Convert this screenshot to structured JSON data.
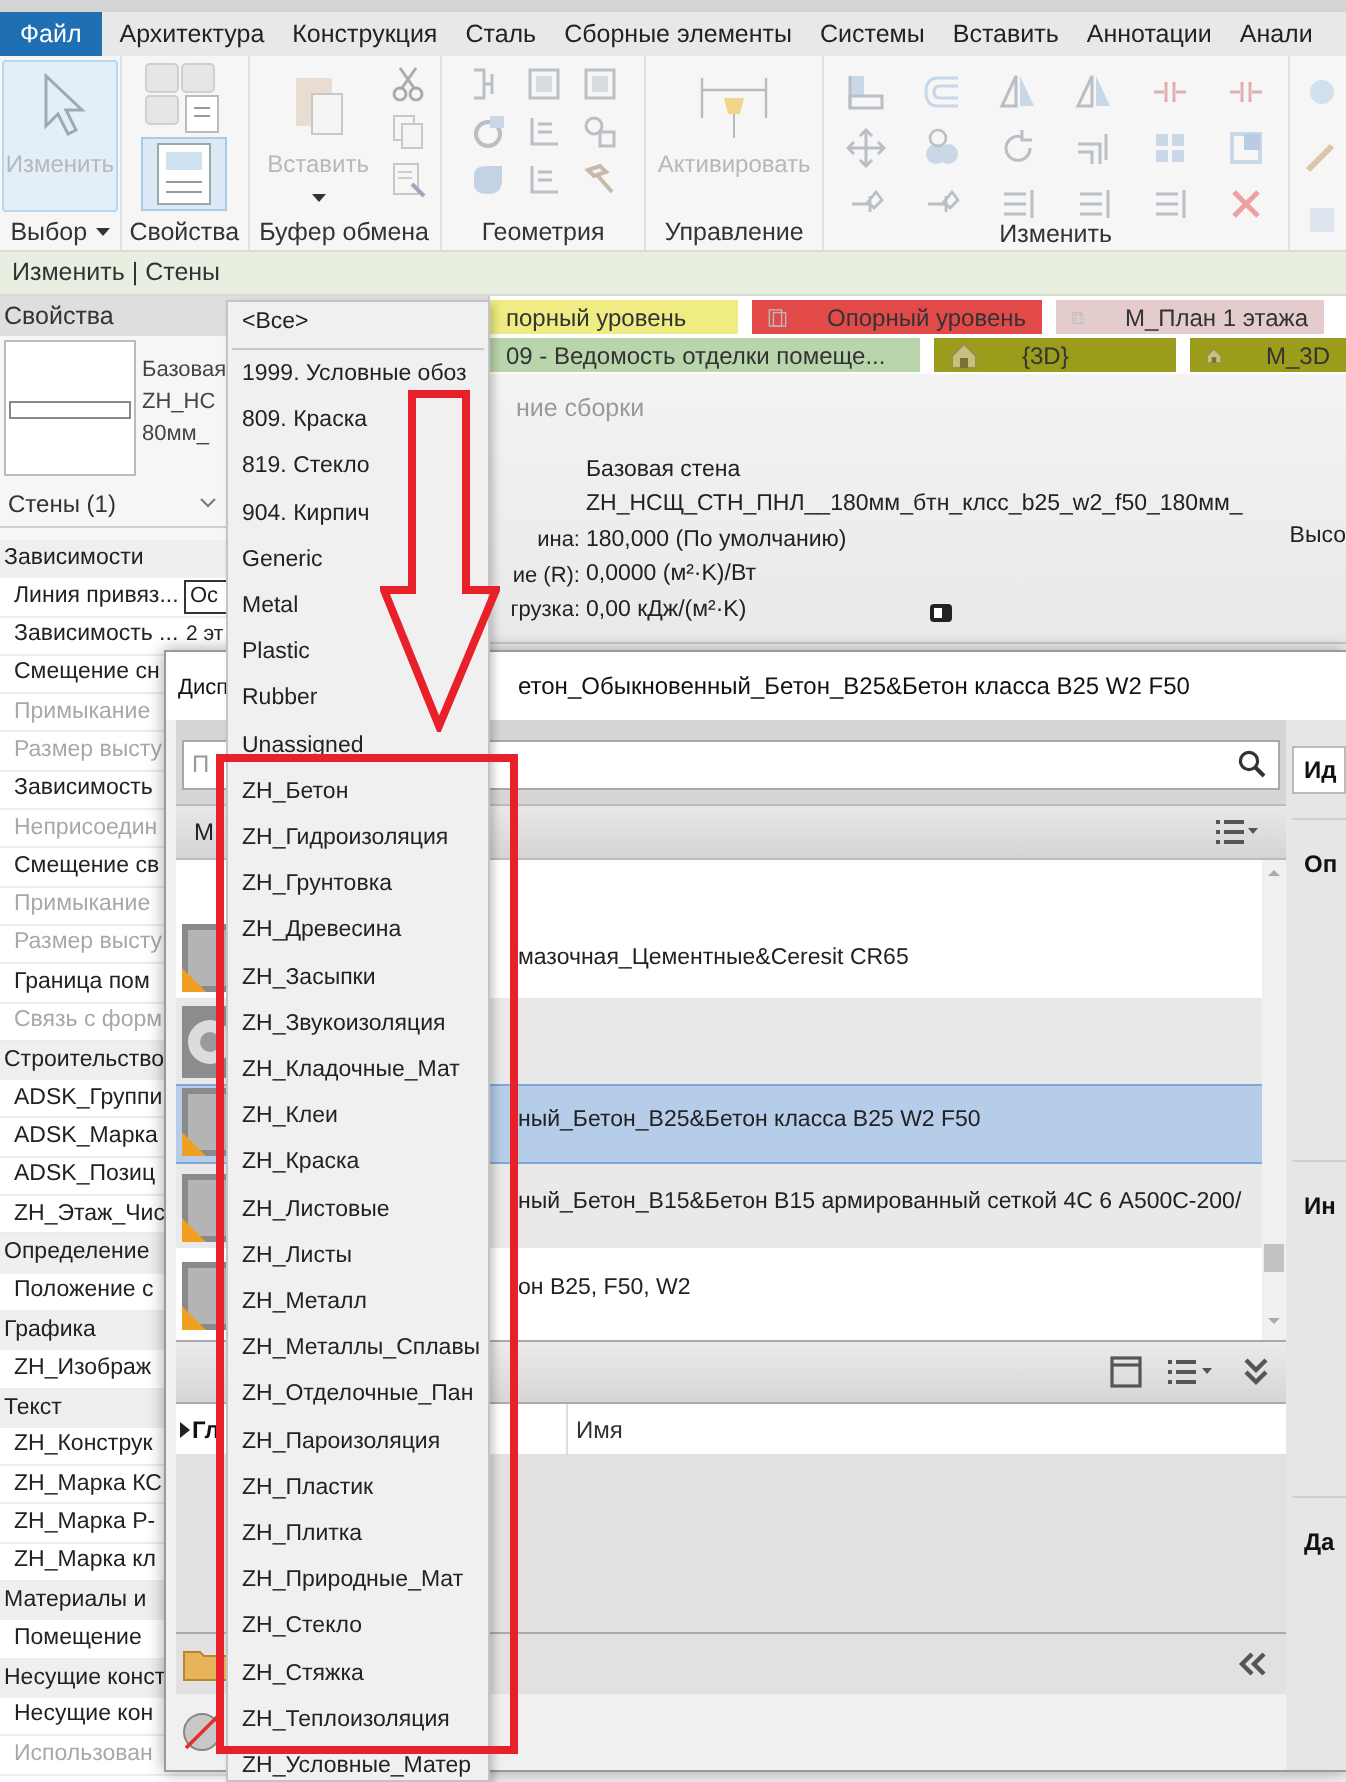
{
  "ribbon": {
    "tabs": [
      {
        "label": "Файл",
        "selected": true
      },
      {
        "label": "Архитектура",
        "selected": false
      },
      {
        "label": "Конструкция",
        "selected": false
      },
      {
        "label": "Сталь",
        "selected": false
      },
      {
        "label": "Сборные элементы",
        "selected": false
      },
      {
        "label": "Системы",
        "selected": false
      },
      {
        "label": "Вставить",
        "selected": false
      },
      {
        "label": "Аннотации",
        "selected": false
      },
      {
        "label": "Анали",
        "selected": false
      }
    ],
    "panels": [
      {
        "label": "Выбор",
        "has_menu": true,
        "button": {
          "label": "Изменить",
          "selected": true,
          "disabled": true
        }
      },
      {
        "label": "Свойства",
        "has_menu": false
      },
      {
        "label": "Буфер обмена",
        "has_menu": false,
        "button": {
          "label": "Вставить",
          "selected": false,
          "disabled": true
        }
      },
      {
        "label": "Геометрия",
        "has_menu": false
      },
      {
        "label": "Управление",
        "has_menu": false,
        "button": {
          "label": "Активировать",
          "selected": false,
          "disabled": true
        }
      },
      {
        "label": "Изменить",
        "has_menu": false
      }
    ]
  },
  "context_bar": {
    "title": "Изменить | Стены"
  },
  "properties": {
    "title": "Свойства",
    "type_lines": [
      "Базовая",
      "ZH_НС",
      "80мм_"
    ],
    "filter": "Стены (1)",
    "rows": [
      {
        "kind": "category",
        "label": "Зависимости",
        "disabled": false
      },
      {
        "kind": "field",
        "label": "Линия привяз...",
        "value": "Ос",
        "disabled": false
      },
      {
        "kind": "param",
        "label": "Зависимость ...",
        "value": "2 эт",
        "disabled": false
      },
      {
        "kind": "param",
        "label": "Смещение сн",
        "disabled": false
      },
      {
        "kind": "param",
        "label": "Примыкание",
        "disabled": true
      },
      {
        "kind": "param",
        "label": "Размер высту",
        "disabled": true
      },
      {
        "kind": "param",
        "label": "Зависимость",
        "disabled": false
      },
      {
        "kind": "param",
        "label": "Неприсоедин",
        "disabled": true
      },
      {
        "kind": "param",
        "label": "Смещение св",
        "disabled": false
      },
      {
        "kind": "param",
        "label": "Примыкание",
        "disabled": true
      },
      {
        "kind": "param",
        "label": "Размер высту",
        "disabled": true
      },
      {
        "kind": "param",
        "label": "Граница пом",
        "disabled": false
      },
      {
        "kind": "param",
        "label": "Связь с форм",
        "disabled": true
      },
      {
        "kind": "category",
        "label": "Строительство",
        "disabled": false
      },
      {
        "kind": "param",
        "label": "ADSK_Группи",
        "disabled": false
      },
      {
        "kind": "param",
        "label": "ADSK_Марка",
        "disabled": false
      },
      {
        "kind": "param",
        "label": "ADSK_Позиц",
        "disabled": false
      },
      {
        "kind": "param",
        "label": "ZH_Этаж_Чис",
        "disabled": false
      },
      {
        "kind": "category",
        "label": "Определение",
        "disabled": false
      },
      {
        "kind": "param",
        "label": "Положение с",
        "disabled": false
      },
      {
        "kind": "category",
        "label": "Графика",
        "disabled": false
      },
      {
        "kind": "param",
        "label": "ZH_Изображ",
        "disabled": false
      },
      {
        "kind": "category",
        "label": "Текст",
        "disabled": false
      },
      {
        "kind": "param",
        "label": "ZH_Конструк",
        "disabled": false
      },
      {
        "kind": "param",
        "label": "ZH_Марка КС",
        "disabled": false
      },
      {
        "kind": "param",
        "label": "ZH_Марка Р-",
        "disabled": false
      },
      {
        "kind": "param",
        "label": "ZH_Марка кл",
        "disabled": false
      },
      {
        "kind": "category",
        "label": "Материалы и",
        "disabled": false
      },
      {
        "kind": "param",
        "label": "Помещение",
        "disabled": false
      },
      {
        "kind": "category",
        "label": "Несущие конст",
        "disabled": false
      },
      {
        "kind": "param",
        "label": "Несущие кон",
        "disabled": false
      },
      {
        "kind": "param",
        "label": "Использован",
        "disabled": true
      }
    ]
  },
  "view_tabs": [
    {
      "tabs": [
        {
          "label": "порный уровень",
          "kind": "plain",
          "color": "#eeec82"
        },
        {
          "label": "Опорный уровень",
          "kind": "plan",
          "color": "#e24a4a"
        },
        {
          "label": "М_План 1 этажа",
          "kind": "plan",
          "color": "#e4cccc"
        }
      ]
    },
    {
      "tabs": [
        {
          "label": "09 - Ведомость отделки помеще...",
          "kind": "plain",
          "color": "#b9d5ab"
        },
        {
          "label": "{3D}",
          "kind": "model",
          "color": "#9b9b1c"
        },
        {
          "label": "М_3D",
          "kind": "model",
          "color": "#9b9b1c"
        }
      ]
    }
  ],
  "type_panel": {
    "heading": "ние сборки",
    "rows": [
      {
        "value": "Базовая стена"
      },
      {
        "value": "ZH_НСЩ_СТН_ПНЛ__180мм_бтн_клсс_b25_w2_f50_180мм_"
      },
      {
        "label": "ина:",
        "value": "180,000 (По умолчанию)"
      },
      {
        "label": "ие (R):",
        "value": "0,0000 (м²·K)/Вт"
      },
      {
        "label": "грузка:",
        "value": "0,00 кДж/(м²·K)"
      }
    ],
    "side_label": "Высо"
  },
  "dialog": {
    "title_start": "Дисп",
    "title_end": "етон_Обыкновенный_Бетон_B25&Бетон класса B25 W2 F50",
    "search_placeholder": "П",
    "list_header": "М",
    "materials": [
      {
        "kind": "cube",
        "name": "мазочная_Цементные&Ceresit CR65",
        "selected": false
      },
      {
        "kind": "disc",
        "selected": false
      },
      {
        "kind": "cube",
        "name": "ный_Бетон_B25&Бетон класса B25 W2 F50",
        "selected": true
      },
      {
        "kind": "cube",
        "name": "ный_Бетон_B15&Бетон B15 армированный сеткой 4С 6 А500С-200/",
        "selected": false
      },
      {
        "kind": "cube",
        "name": "он B25, F50, W2",
        "selected": false
      }
    ],
    "table": {
      "column_1": "Гл",
      "column_2": "Имя"
    },
    "side_tab": "Ид",
    "side_sections": [
      "Оп",
      "Ин",
      "Да"
    ]
  },
  "dropdown": {
    "items": [
      {
        "label": "<Все>",
        "selected": false
      },
      {
        "label": "1999. Условные обоз",
        "selected": false
      },
      {
        "label": "809. Краска",
        "selected": false
      },
      {
        "label": "819. Стекло",
        "selected": false
      },
      {
        "label": "904. Кирпич",
        "selected": false
      },
      {
        "label": "Generic",
        "selected": false
      },
      {
        "label": "Metal",
        "selected": false
      },
      {
        "label": "Plastic",
        "selected": false
      },
      {
        "label": "Rubber",
        "selected": false
      },
      {
        "label": "Unassigned",
        "selected": false
      },
      {
        "label": "ZH_Бетон",
        "selected": false
      },
      {
        "label": "ZH_Гидроизоляция",
        "selected": false
      },
      {
        "label": "ZH_Грунтовка",
        "selected": false
      },
      {
        "label": "ZH_Древесина",
        "selected": false
      },
      {
        "label": "ZH_Засыпки",
        "selected": false
      },
      {
        "label": "ZH_Звукоизоляция",
        "selected": false
      },
      {
        "label": "ZH_Кладочные_Мат",
        "selected": false
      },
      {
        "label": "ZH_Клеи",
        "selected": false
      },
      {
        "label": "ZH_Краска",
        "selected": false
      },
      {
        "label": "ZH_Листовые",
        "selected": false
      },
      {
        "label": "ZH_Листы",
        "selected": false
      },
      {
        "label": "ZH_Металл",
        "selected": false
      },
      {
        "label": "ZH_Металлы_Сплавы",
        "selected": false
      },
      {
        "label": "ZH_Отделочные_Пан",
        "selected": false
      },
      {
        "label": "ZH_Пароизоляция",
        "selected": false
      },
      {
        "label": "ZH_Пластик",
        "selected": false
      },
      {
        "label": "ZH_Плитка",
        "selected": false
      },
      {
        "label": "ZH_Природные_Мат",
        "selected": false
      },
      {
        "label": "ZH_Стекло",
        "selected": false
      },
      {
        "label": "ZH_Стяжка",
        "selected": false
      },
      {
        "label": "ZH_Теплоизоляция",
        "selected": false
      },
      {
        "label": "ZH_Условные_Матер",
        "selected": false
      }
    ]
  }
}
